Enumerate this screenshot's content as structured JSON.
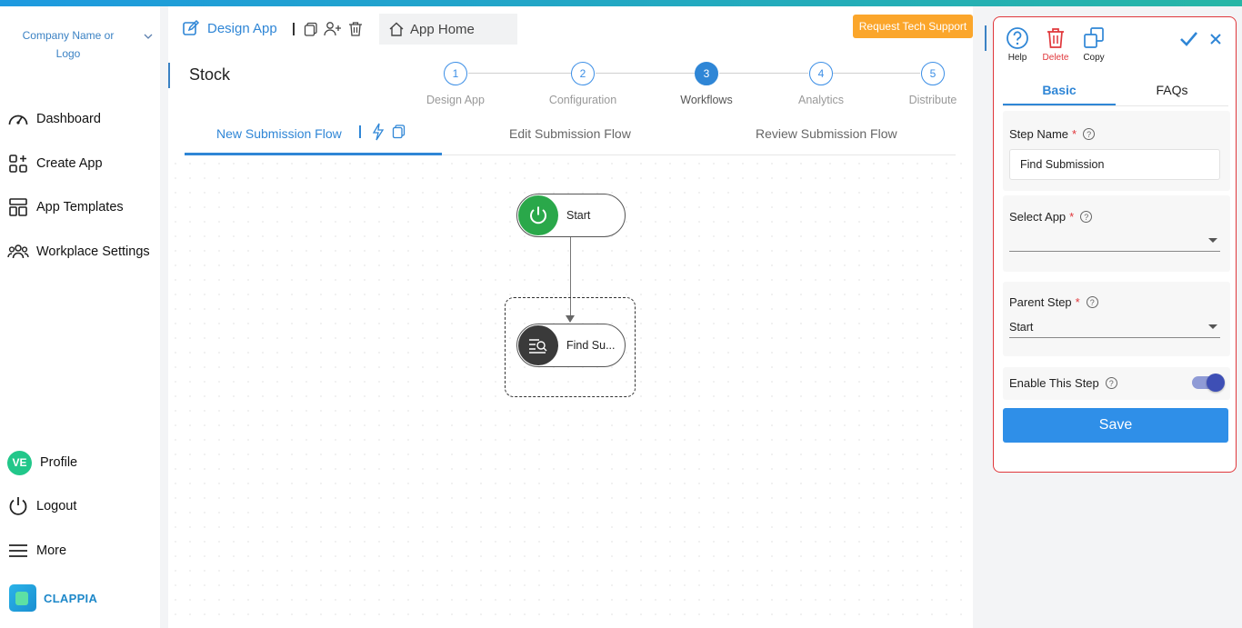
{
  "sidebar": {
    "company": "Company Name or Logo",
    "nav": [
      "Dashboard",
      "Create App",
      "App Templates",
      "Workplace Settings"
    ],
    "profile_initials": "VE",
    "profile": "Profile",
    "logout": "Logout",
    "more": "More",
    "brand": "CLAPPIA"
  },
  "header": {
    "design_app": "Design App",
    "app_home": "App Home",
    "support": "Request Tech Support"
  },
  "page_title": "Stock",
  "steps": [
    {
      "num": "1",
      "label": "Design App"
    },
    {
      "num": "2",
      "label": "Configuration"
    },
    {
      "num": "3",
      "label": "Workflows"
    },
    {
      "num": "4",
      "label": "Analytics"
    },
    {
      "num": "5",
      "label": "Distribute"
    }
  ],
  "flow_tabs": [
    "New Submission Flow",
    "Edit Submission Flow",
    "Review Submission Flow"
  ],
  "nodes": {
    "start": "Start",
    "find": "Find Su..."
  },
  "panel": {
    "help": "Help",
    "delete": "Delete",
    "copy": "Copy",
    "tabs": [
      "Basic",
      "FAQs"
    ],
    "step_name_label": "Step Name",
    "step_name_value": "Find Submission",
    "select_app_label": "Select App",
    "select_app_value": "",
    "parent_step_label": "Parent Step",
    "parent_step_value": "Start",
    "enable_label": "Enable This Step",
    "enabled": true,
    "required_mark": "*",
    "save": "Save"
  },
  "colors": {
    "accent": "#2f86d6",
    "support": "#fba62b",
    "danger": "#e0373b",
    "start_node": "#2aa84a",
    "find_node": "#3a3a3a"
  }
}
